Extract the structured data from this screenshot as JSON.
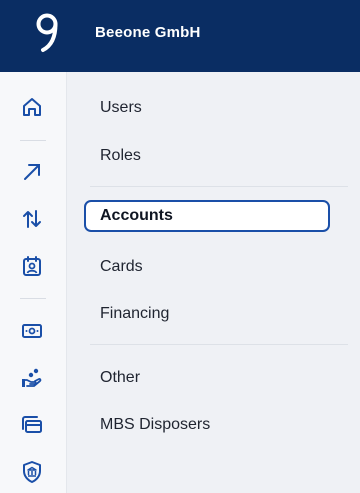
{
  "header": {
    "company": "Beeone GmbH"
  },
  "rail": {
    "icons": [
      "home-icon",
      "arrow-up-right-icon",
      "transfer-icon",
      "calendar-id-icon",
      "cash-icon",
      "hand-coins-icon",
      "cards-icon",
      "bank-shield-icon"
    ],
    "accent": "#1a4fa8"
  },
  "menu": {
    "users": "Users",
    "roles": "Roles",
    "accounts": "Accounts",
    "cards": "Cards",
    "financing": "Financing",
    "other": "Other",
    "mbs_disposers": "MBS Disposers"
  },
  "colors": {
    "header_bg": "#0a2d63",
    "active_border": "#1a4fa8"
  }
}
